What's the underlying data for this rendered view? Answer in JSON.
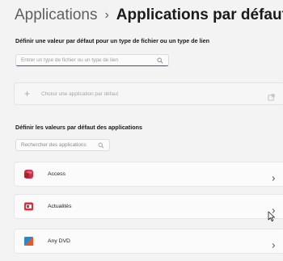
{
  "breadcrumb": {
    "parent": "Applications",
    "separator": "›",
    "current": "Applications par défaut"
  },
  "file_type_section": {
    "label": "Définir une valeur par défaut pour un type de fichier ou un type de lien",
    "search_placeholder": "Entrer un type de fichier ou un type de lien",
    "search_icon": "search-icon"
  },
  "choose_app": {
    "label": "Choisir une application par défaut",
    "icon": "plus-icon",
    "trailing_icon": "external-link-icon"
  },
  "apps_section": {
    "label": "Définir les valeurs par défaut des applications",
    "search_placeholder": "Rechercher des applications",
    "search_icon": "search-icon"
  },
  "apps": [
    {
      "name": "Access",
      "icon": "access-app-icon",
      "color": "#c4314b"
    },
    {
      "name": "Actualités",
      "icon": "news-app-icon",
      "color": "#d13438"
    },
    {
      "name": "Any DVD",
      "icon": "anydvd-app-icon",
      "color": "#1f8ad6"
    }
  ],
  "colors": {
    "accent": "#005fb8",
    "background": "#f3f3f3",
    "card": "#fbfbfb"
  }
}
